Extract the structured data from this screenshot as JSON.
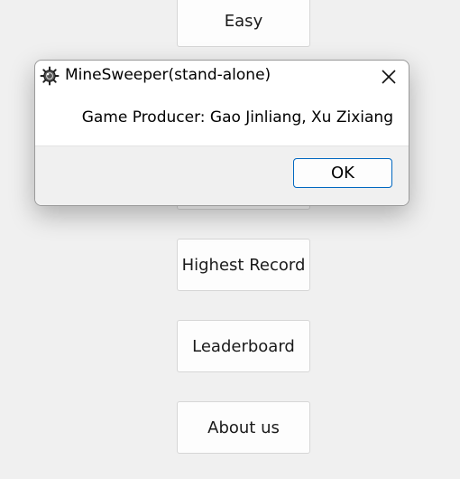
{
  "menu": {
    "easy_label": "Easy",
    "highest_record_label": "Highest Record",
    "leaderboard_label": "Leaderboard",
    "about_us_label": "About us"
  },
  "dialog": {
    "title": "MineSweeper(stand-alone)",
    "app_icon": "mine-icon",
    "close_icon": "close-icon",
    "message": "Game Producer: Gao Jinliang, Xu Zixiang",
    "ok_label": "OK"
  },
  "colors": {
    "background": "#f0f0f0",
    "button_face": "#fdfdfd",
    "ok_border_accent": "#0067c0"
  }
}
